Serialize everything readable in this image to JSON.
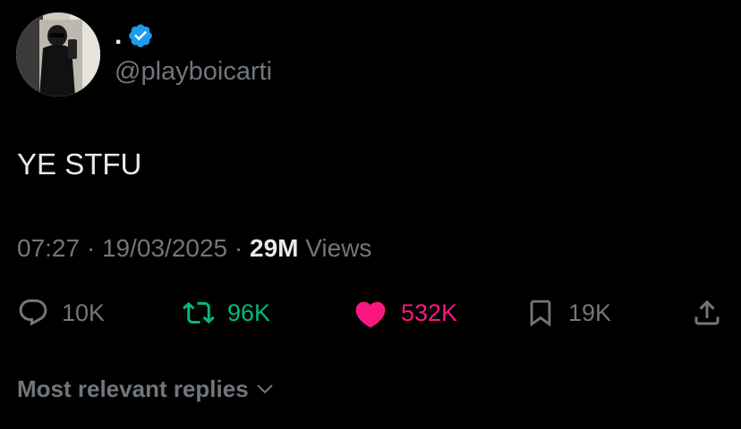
{
  "author": {
    "display_name": ".",
    "handle": "@playboicarti",
    "verified": true,
    "verified_color": "#1d9bf0",
    "avatar_icon": "profile-photo-mirror-selfie"
  },
  "tweet": {
    "text": "YE STFU",
    "time": "07:27",
    "separator": "·",
    "date": "19/03/2025",
    "views_count": "29M",
    "views_label": "Views"
  },
  "actions": {
    "reply": {
      "icon": "speech-bubble-icon",
      "count": "10K",
      "color": "#71767b"
    },
    "retweet": {
      "icon": "retweet-arrows-icon",
      "count": "96K",
      "color": "#00ba7c"
    },
    "like": {
      "icon": "heart-icon",
      "count": "532K",
      "color": "#f91880"
    },
    "bookmark": {
      "icon": "bookmark-icon",
      "count": "19K",
      "color": "#71767b"
    },
    "share": {
      "icon": "share-upload-icon"
    }
  },
  "replies": {
    "sort_label": "Most relevant replies",
    "sort_icon": "chevron-down-icon"
  },
  "colors": {
    "background": "#000000",
    "primary_text": "#e7e9ea",
    "secondary_text": "#71767b"
  }
}
